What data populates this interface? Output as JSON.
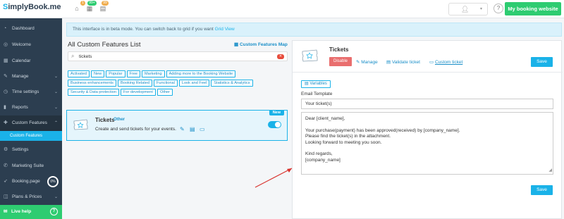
{
  "header": {
    "logo_prefix": "S",
    "logo_name": "implyBook",
    "logo_suffix": ".me",
    "badge_1": "1",
    "badge_2": "99+",
    "badge_3": "99",
    "my_booking_website": "My booking website"
  },
  "sidebar": {
    "items": [
      {
        "label": "Dashboard"
      },
      {
        "label": "Welcome"
      },
      {
        "label": "Calendar"
      },
      {
        "label": "Manage"
      },
      {
        "label": "Time settings"
      },
      {
        "label": "Reports"
      },
      {
        "label": "Custom Features"
      },
      {
        "label": "Settings"
      },
      {
        "label": "Marketing Suite"
      },
      {
        "label": "Booking.page"
      },
      {
        "label": "Plans & Prices"
      }
    ],
    "sub_item": "Custom Features",
    "booking_progress": "0%",
    "live_help": "Live help"
  },
  "beta": {
    "text": "This interface is in beta mode. You can switch back to grid if you want ",
    "link": "Grid View"
  },
  "list": {
    "title": "All Custom Features List",
    "map_link": "Custom Features Map",
    "search_value": "tickets",
    "tags": [
      "Activated",
      "New",
      "Popular",
      "Free",
      "Marketing",
      "Adding more to the Booking Website",
      "Business enhancements",
      "Booking Related",
      "Functional",
      "Look and Feel",
      "Statistics & Analytics",
      "Security & Data protection",
      "For development",
      "Other"
    ]
  },
  "card": {
    "name": "Tickets",
    "category": "Other",
    "description": "Create and send tickets for your events.",
    "badge": "New",
    "enabled": true
  },
  "detail": {
    "title": "Tickets",
    "disable": "Disable",
    "manage": "Manage",
    "validate": "Validate ticket",
    "custom": "Custom ticket",
    "save": "Save",
    "variables": "Variables",
    "email_template_label": "Email Template",
    "subject": "Your ticket(s)",
    "body_lines": [
      "Dear [client_name],",
      "",
      "Your purchase(payment) has been approved(received) by [company_name].",
      "Please find the ticket(s) in the attachment.",
      "Looking forward to meeting you soon.",
      "",
      "Kind regards,",
      "[company_name]"
    ]
  },
  "colors": {
    "sidebar": "#2c3e50",
    "accent": "#1ab2e8",
    "green": "#2ecc71",
    "danger": "#e96e6e"
  }
}
